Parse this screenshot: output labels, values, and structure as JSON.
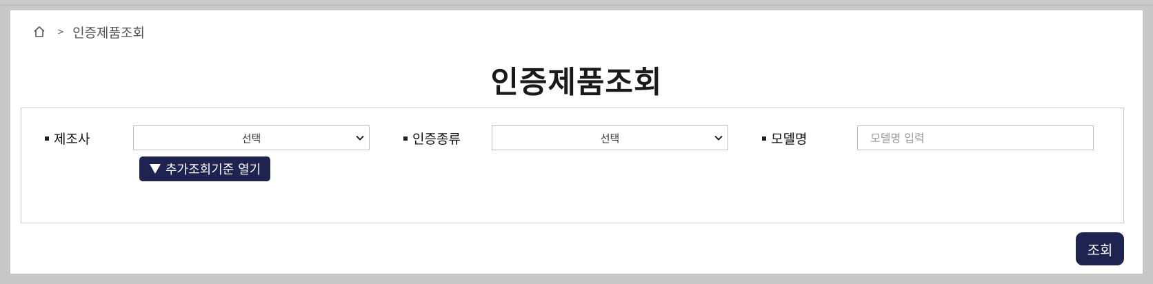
{
  "breadcrumb": {
    "home_icon": "home-icon",
    "separator": ">",
    "current": "인증제품조회"
  },
  "page_title": "인증제품조회",
  "filters": {
    "manufacturer": {
      "label": "제조사",
      "selected": "선택"
    },
    "cert_type": {
      "label": "인증종류",
      "selected": "선택"
    },
    "model_name": {
      "label": "모델명",
      "value": "",
      "placeholder": "모델명 입력"
    }
  },
  "more_criteria_button": {
    "icon": "triangle-down-icon",
    "label": "추가조회기준 열기"
  },
  "search_button": {
    "label": "조회"
  },
  "colors": {
    "accent": "#1e2350",
    "background": "#c8c8c8",
    "panel": "#ffffff"
  }
}
